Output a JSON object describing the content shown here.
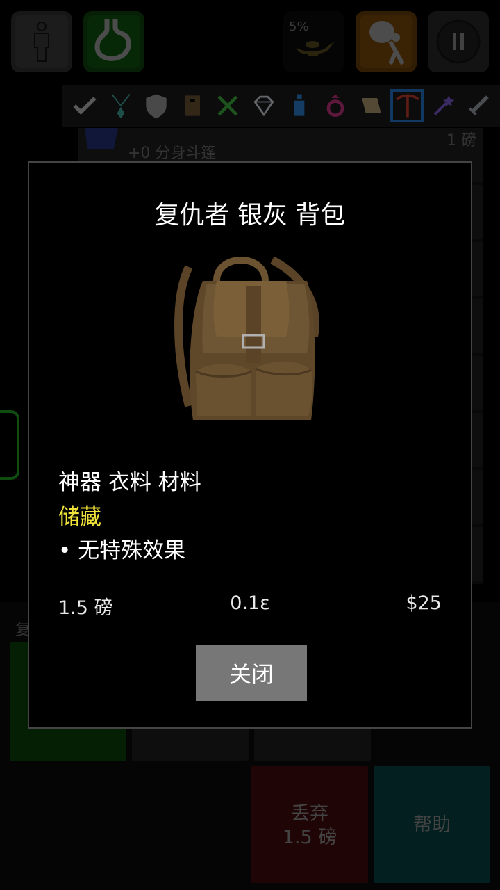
{
  "top_bar": {
    "character_icon": "person-icon",
    "hunger_icon": "stomach-icon",
    "lamp_percent": "5%",
    "lamp_icon": "magic-lamp-icon",
    "loot_icon": "thief-sack-icon",
    "pause_icon": "pause-icon"
  },
  "categories": [
    {
      "icon": "check-icon",
      "color": "#bbbbbb"
    },
    {
      "icon": "amulet-icon",
      "color": "#3fa39a"
    },
    {
      "icon": "shield-icon",
      "color": "#9a9a9a"
    },
    {
      "icon": "book-icon",
      "color": "#6a5232"
    },
    {
      "icon": "fork-knife-icon",
      "color": "#3cae3c"
    },
    {
      "icon": "gem-icon",
      "color": "#cfd8e0"
    },
    {
      "icon": "potion-icon",
      "color": "#2a7fd4"
    },
    {
      "icon": "ring-icon",
      "color": "#c9307f"
    },
    {
      "icon": "scroll-icon",
      "color": "#b09a70"
    },
    {
      "icon": "pickaxe-icon",
      "color": "#c33a2a"
    },
    {
      "icon": "wand-icon",
      "color": "#7a5ad0"
    },
    {
      "icon": "sword-icon",
      "color": "#9aa0a8"
    }
  ],
  "background_list": {
    "first_item_name": "+0 分身斗篷",
    "first_item_weight": "1 磅",
    "partial_label": "复"
  },
  "modal": {
    "title": "复仇者 银灰 背包",
    "image_icon": "backpack-image",
    "categories_text": "神器 衣料 材料",
    "tag": "储藏",
    "effect": "• 无特殊效果",
    "weight": "1.5 磅",
    "volume": "0.1ε",
    "price": "$25",
    "close_label": "关闭"
  },
  "bottom_actions": {
    "drop_label": "丢弃\n1.5 磅",
    "help_label": "帮助"
  },
  "colors": {
    "tag_yellow": "#f2e33a",
    "selected_tab": "#1f67b0",
    "drop_red": "#3a0a0a",
    "help_teal": "#073a3a",
    "green": "#0a3a0a"
  }
}
